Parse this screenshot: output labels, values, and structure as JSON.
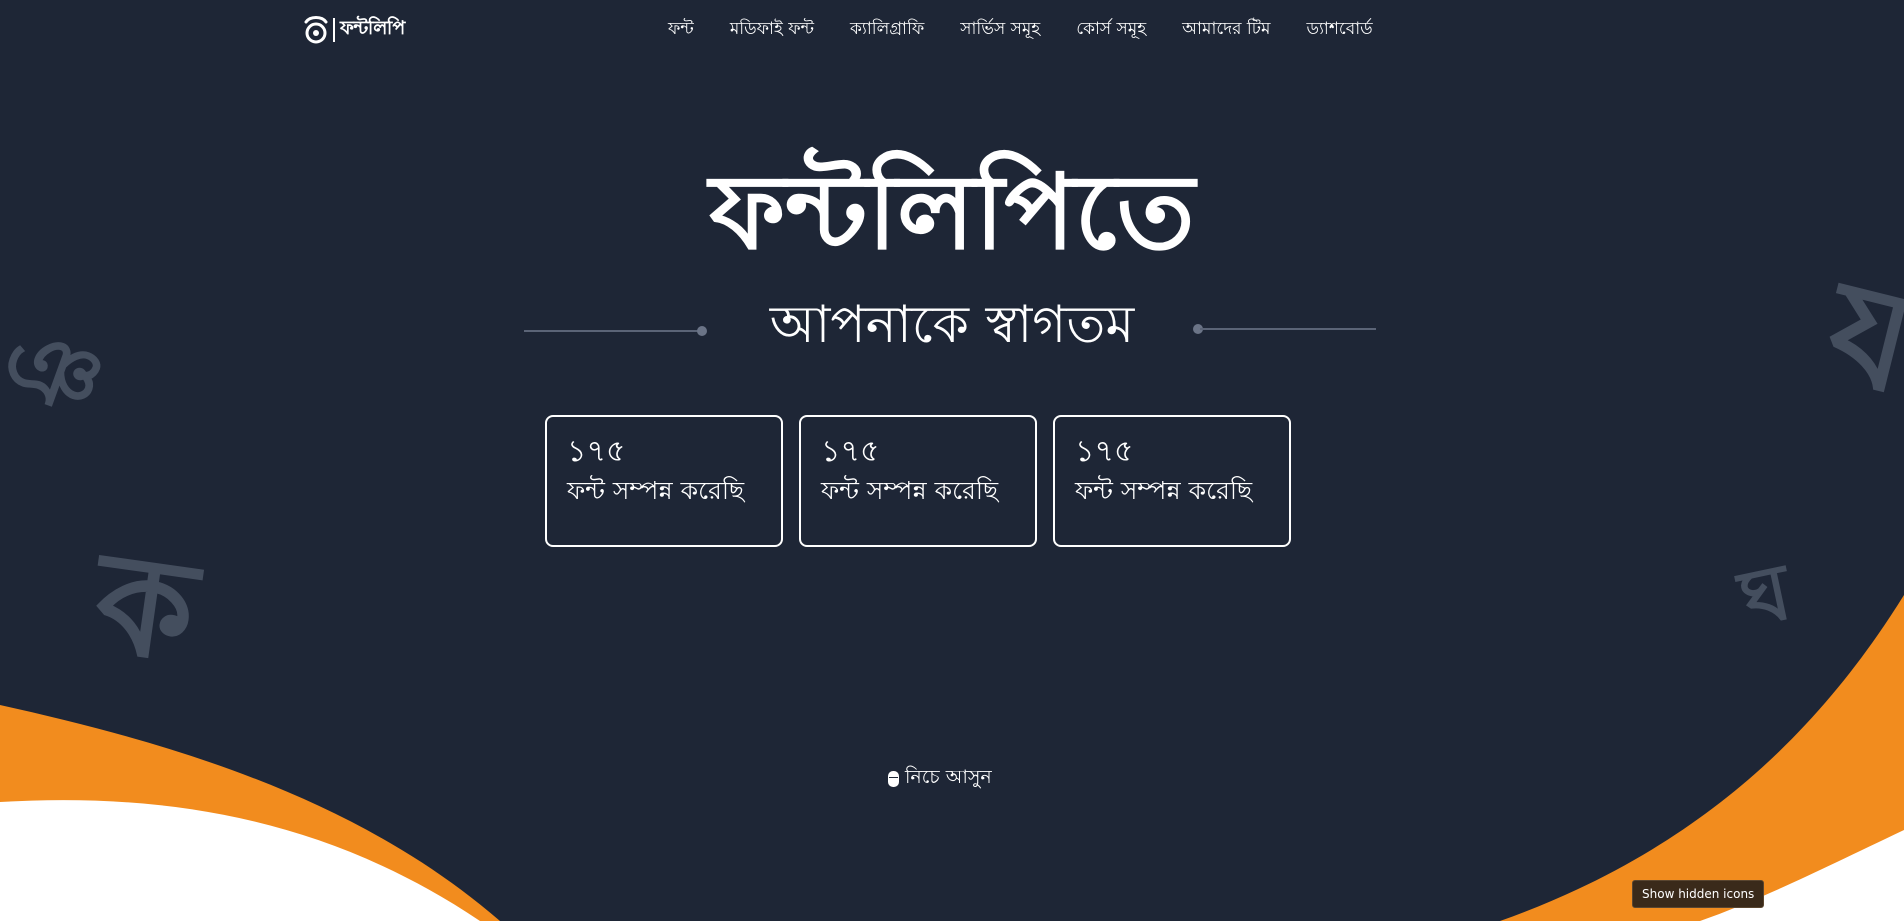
{
  "brand": {
    "logo_text": "ফন্টলিপি",
    "logo_icon": "fontlipi-logo-icon"
  },
  "nav": {
    "items": [
      {
        "label": "ফন্ট"
      },
      {
        "label": "মডিফাই ফন্ট"
      },
      {
        "label": "ক্যালিগ্রাফি"
      },
      {
        "label": "সার্ভিস সমূহ"
      },
      {
        "label": "কোর্স সমূহ"
      },
      {
        "label": "আমাদের টিম"
      },
      {
        "label": "ড্যাশবোর্ড"
      }
    ]
  },
  "hero": {
    "title": "ফন্টলিপিতে",
    "subtitle": "আপনাকে স্বাগতম"
  },
  "stats": [
    {
      "number": "১৭৫",
      "label": "ফন্ট সম্পন্ন করেছি"
    },
    {
      "number": "১৭৫",
      "label": "ফন্ট সম্পন্ন করেছি"
    },
    {
      "number": "১৭৫",
      "label": "ফন্ট সম্পন্ন করেছি"
    }
  ],
  "watermarks": {
    "left_top": "ঞ",
    "left_bottom": "ক",
    "right_top": "য",
    "right_bottom": "ঘ"
  },
  "scroll_hint": {
    "label": "নিচে আসুন",
    "icon": "mouse-icon"
  },
  "tray": {
    "tooltip": "Show hidden icons"
  },
  "colors": {
    "background": "#1e2636",
    "accent": "#f28c1e",
    "text": "#ffffff"
  }
}
